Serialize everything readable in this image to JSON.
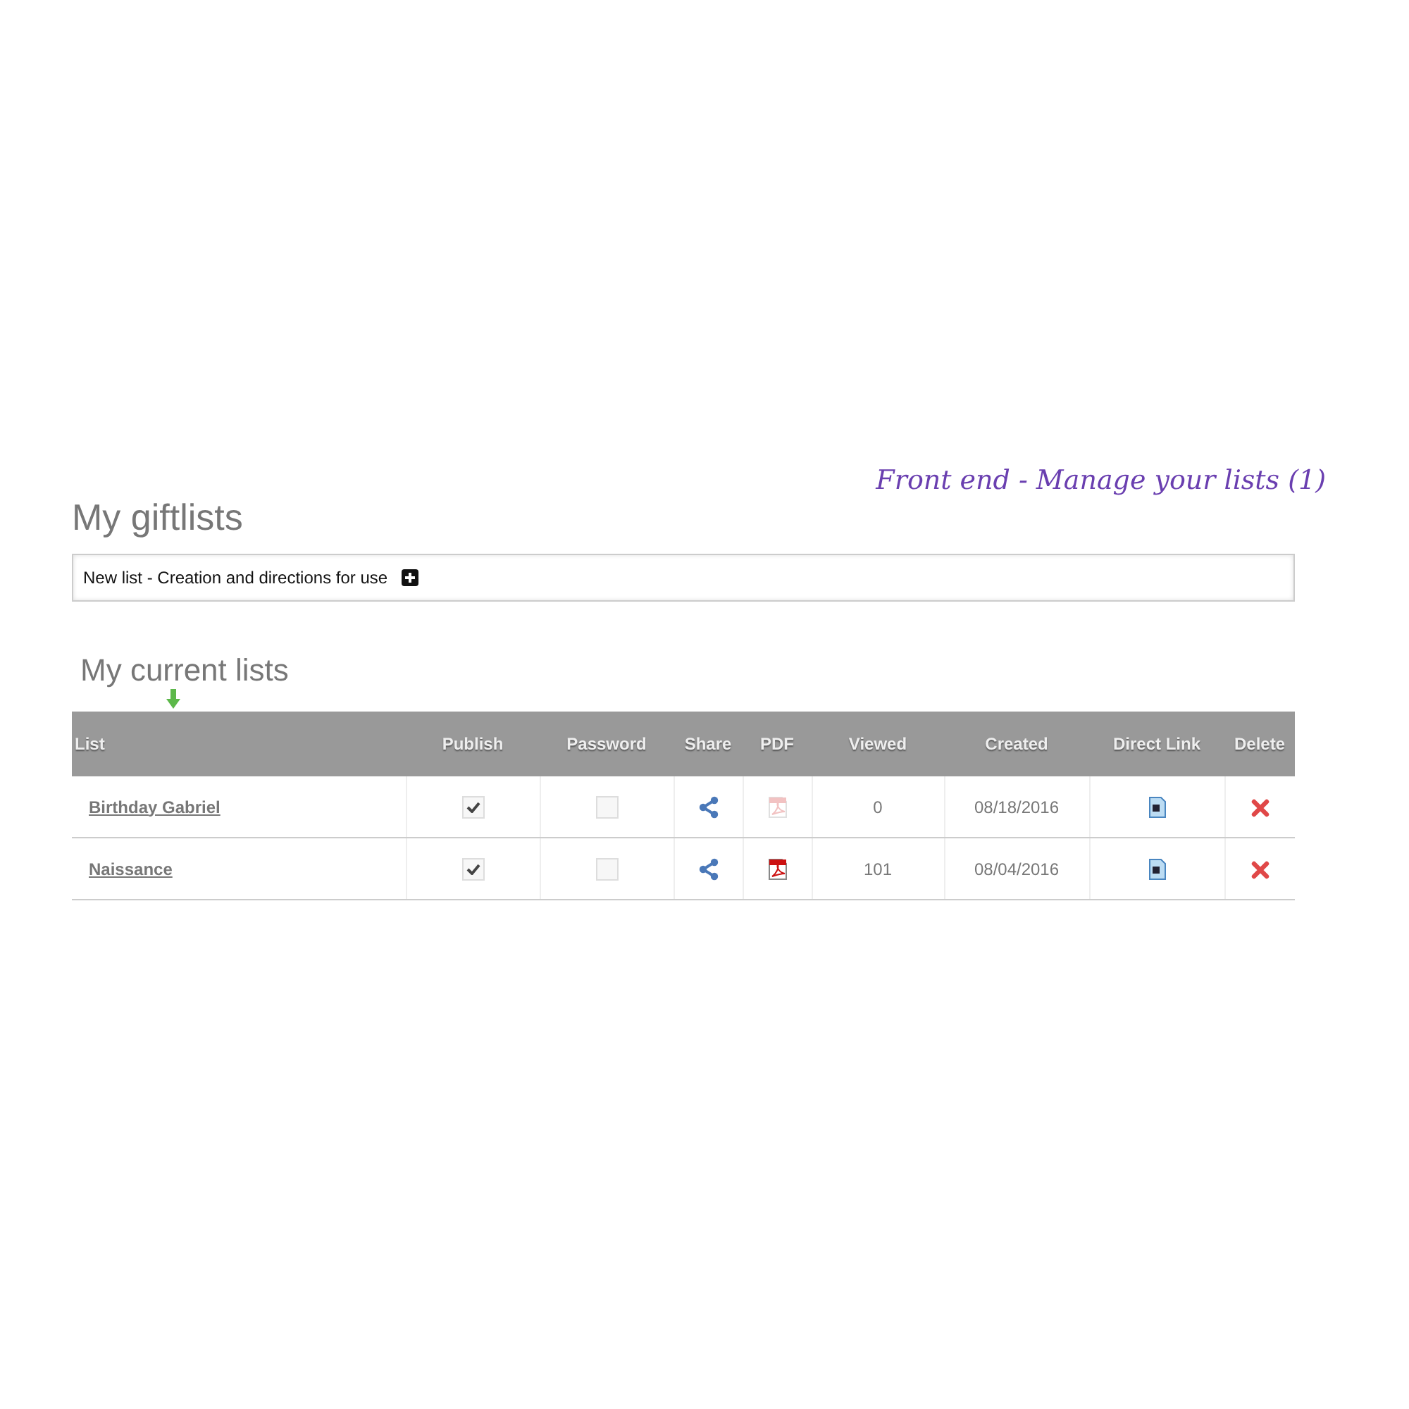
{
  "caption": "Front end - Manage your lists (1)",
  "title": "My giftlists",
  "new_list": {
    "label": "New list - Creation and directions for use"
  },
  "section_title": "My current lists",
  "table": {
    "columns": [
      "List",
      "Publish",
      "Password",
      "Share",
      "PDF",
      "Viewed",
      "Created",
      "Direct Link",
      "Delete"
    ],
    "rows": [
      {
        "name": "Birthday Gabriel",
        "published": true,
        "password": false,
        "pdf_available": false,
        "viewed": "0",
        "created": "08/18/2016"
      },
      {
        "name": "Naissance",
        "published": true,
        "password": false,
        "pdf_available": true,
        "viewed": "101",
        "created": "08/04/2016"
      }
    ]
  }
}
